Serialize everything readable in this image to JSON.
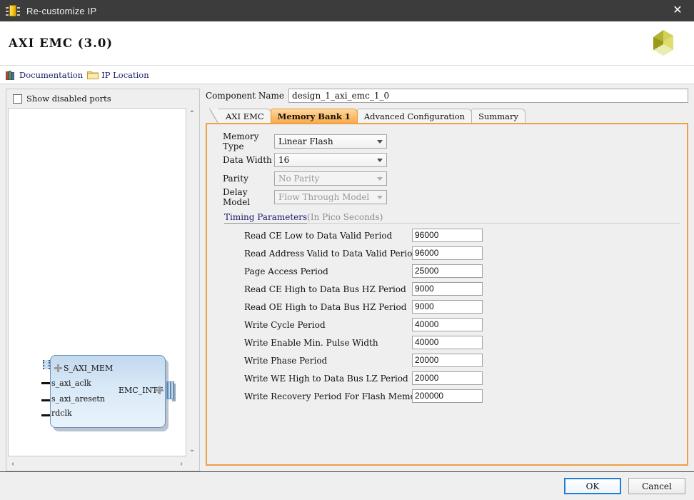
{
  "window": {
    "title": "Re-customize IP",
    "icon": "ip-chip-icon",
    "close_label": "✕"
  },
  "header": {
    "ip_title": "AXI EMC (3.0)",
    "logo": "xilinx-logo"
  },
  "links": [
    {
      "label": "Documentation",
      "icon": "books-icon"
    },
    {
      "label": "IP Location",
      "icon": "folder-icon"
    }
  ],
  "left_pane": {
    "show_disabled_ports": {
      "label": "Show disabled ports",
      "checked": false
    },
    "diagram": {
      "block_name": "axi_emc_block",
      "bus_ports": [
        {
          "label": "S_AXI_MEM",
          "side": "left"
        },
        {
          "label": "EMC_INTF",
          "side": "right"
        }
      ],
      "signal_ports": [
        {
          "label": "s_axi_aclk"
        },
        {
          "label": "s_axi_aresetn"
        },
        {
          "label": "rdclk"
        }
      ]
    },
    "scroll": {
      "up": "⌃",
      "down": "⌄",
      "left": "‹",
      "right": "›"
    }
  },
  "component_name": {
    "label": "Component Name",
    "value": "design_1_axi_emc_1_0"
  },
  "tabs": [
    {
      "label": "AXI EMC",
      "active": false
    },
    {
      "label": "Memory Bank 1",
      "active": true
    },
    {
      "label": "Advanced Configuration",
      "active": false
    },
    {
      "label": "Summary",
      "active": false
    }
  ],
  "memory_bank": {
    "fields": [
      {
        "label": "Memory Type",
        "value": "Linear Flash",
        "disabled": false
      },
      {
        "label": "Data Width",
        "value": "16",
        "disabled": false
      },
      {
        "label": "Parity",
        "value": "No Parity",
        "disabled": true
      },
      {
        "label": "Delay Model",
        "value": "Flow Through Model",
        "disabled": true
      }
    ],
    "timing_group": {
      "title": "Timing Parameters",
      "subtitle": "(In Pico Seconds)"
    },
    "timing_parameters": [
      {
        "label": "Read CE Low to Data Valid Period",
        "value": "96000"
      },
      {
        "label": "Read Address Valid to Data Valid Period",
        "value": "96000"
      },
      {
        "label": "Page Access Period",
        "value": "25000"
      },
      {
        "label": "Read CE High to Data Bus HZ Period",
        "value": "9000"
      },
      {
        "label": "Read OE High to Data Bus HZ Period",
        "value": "9000"
      },
      {
        "label": "Write Cycle Period",
        "value": "40000"
      },
      {
        "label": "Write Enable Min. Pulse Width",
        "value": "40000"
      },
      {
        "label": "Write Phase Period",
        "value": "20000"
      },
      {
        "label": "Write WE High to Data Bus LZ Period",
        "value": "20000"
      },
      {
        "label": "Write Recovery Period For Flash Memory",
        "value": "200000"
      }
    ]
  },
  "footer": {
    "ok_label": "OK",
    "cancel_label": "Cancel"
  },
  "colors": {
    "titlebar": "#3c3c3c",
    "accent_orange": "#eda044",
    "active_tab": "#f7ab4e",
    "link_text": "#1b1b6b",
    "ok_border": "#1e7fd4",
    "block_fill": "#d9e9f7",
    "logo_olive": "#9a9a28",
    "logo_light": "#e6e68c"
  }
}
